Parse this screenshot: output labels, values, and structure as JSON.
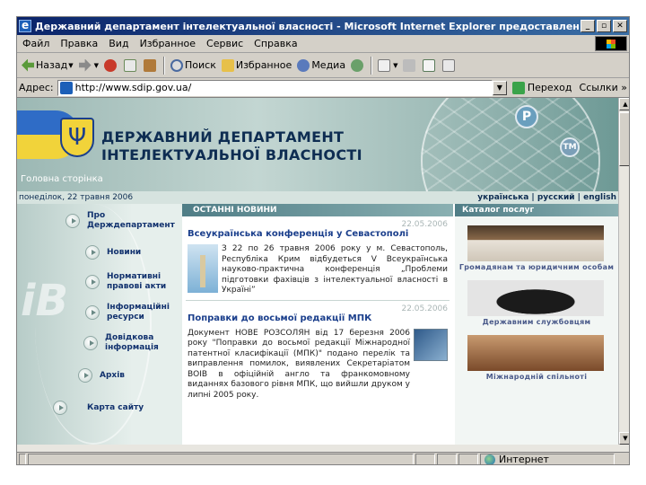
{
  "window": {
    "title": "Державний департамент інтелектуальної власності - Microsoft Internet Explorer предоставлен: ITware"
  },
  "window_buttons": [
    "_",
    "▫",
    "✕"
  ],
  "menu": [
    "Файл",
    "Правка",
    "Вид",
    "Избранное",
    "Сервис",
    "Справка"
  ],
  "toolbar": {
    "back": "Назад",
    "search": "Поиск",
    "favorites": "Избранное",
    "media": "Медиа"
  },
  "address": {
    "label": "Адрес:",
    "url": "http://www.sdip.gov.ua/",
    "go": "Переход",
    "links": "Ссылки"
  },
  "status": {
    "zone": "Интернет"
  },
  "site": {
    "title_line1": "ДЕРЖАВНИЙ ДЕПАРТАМЕНТ",
    "title_line2": "ІНТЕЛЕКТУАЛЬНОЇ ВЛАСНОСТІ",
    "home": "Головна сторінка",
    "date": "понеділок, 22 травня 2006",
    "languages": "українська | русский | english",
    "p_badge": "P",
    "tm_badge": "TM"
  },
  "nav": [
    {
      "label": "Про Держдепартамент"
    },
    {
      "label": "Новини"
    },
    {
      "label": "Нормативні правові акти"
    },
    {
      "label": "Інформаційні ресурси"
    },
    {
      "label": "Довідкова інформація"
    },
    {
      "label": "Архів"
    },
    {
      "label": "Карта сайту"
    }
  ],
  "news": {
    "header": "ОСТАННІ НОВИНИ",
    "items": [
      {
        "date": "22.05.2006",
        "title": "Всеукраїнська конференція у Севастополі",
        "text": "З 22 по 26 травня 2006 року у м. Севастополь, Республіка Крим відбудеться V Всеукраїнська науково-практична конференція „Проблеми підготовки фахівців з інтелектуальної власності в Україні”"
      },
      {
        "date": "22.05.2006",
        "title": "Поправки до восьмої редакції МПК",
        "text": "Документ НОВЕ РОЗСОЛЯН від 17 березня 2006 року \"Поправки до восьмої редакції Міжнародної патентної класифікації (МПК)\" подано перелік та виправлення помилок, виявлених Секретаріатом ВОІВ в офіційній англо та франкомовному виданнях базового рівня МПК, що вийшли друком у липні 2005 року."
      }
    ]
  },
  "catalog": {
    "header": "Каталог послуг",
    "items": [
      {
        "label": "Громадянам та юридичним особам"
      },
      {
        "label": "Державним службовцям"
      },
      {
        "label": "Міжнародній спільноті"
      }
    ]
  }
}
